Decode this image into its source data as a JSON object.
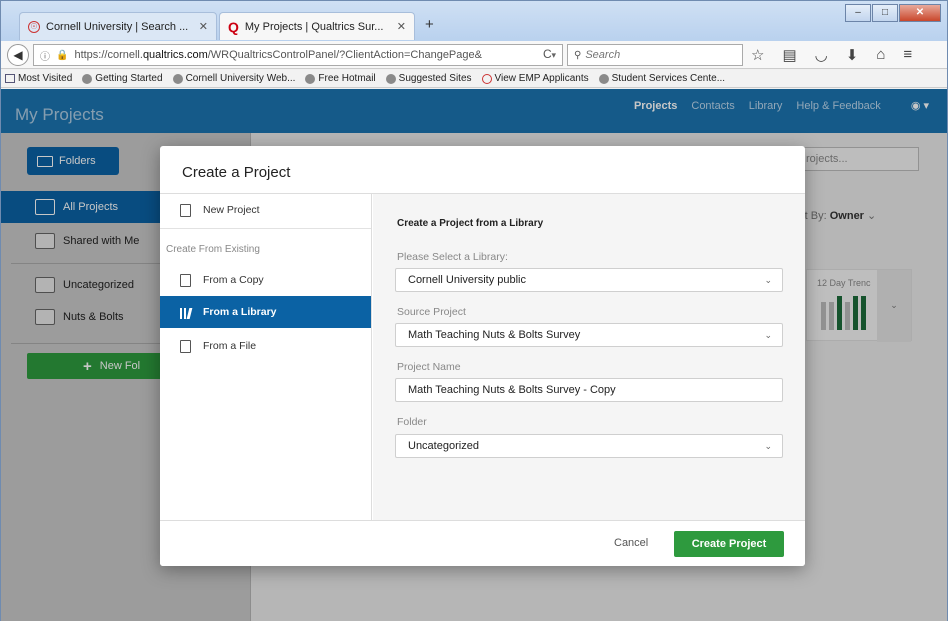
{
  "browser": {
    "tabs": [
      {
        "title": "Cornell University | Search ...",
        "active": false
      },
      {
        "title": "My Projects | Qualtrics Sur...",
        "active": true
      }
    ],
    "new_tab": "+",
    "url_prefix": "https://cornell.",
    "url_domain": "qualtrics.com",
    "url_path": "/WRQualtricsControlPanel/?ClientAction=ChangePage&",
    "search_placeholder": "Search",
    "bookmarks": [
      "Most Visited",
      "Getting Started",
      "Cornell University Web...",
      "Free Hotmail",
      "Suggested Sites",
      "View EMP Applicants",
      "Student Services Cente..."
    ]
  },
  "app": {
    "title": "My Projects",
    "nav": [
      "Projects",
      "Contacts",
      "Library",
      "Help & Feedback"
    ],
    "folders_label": "Folders",
    "sidebar": [
      "All Projects",
      "Shared with Me",
      "Uncategorized",
      "Nuts & Bolts"
    ],
    "new_folder_label": "New Fol",
    "search_placeholder": "rojects...",
    "sort_prefix": "rt By:",
    "sort_value": "Owner",
    "trend_label": "12 Day Trenc",
    "accent": "#1b74b0",
    "green": "#2e9a3e"
  },
  "modal": {
    "title": "Create a Project",
    "left": {
      "new_project": "New Project",
      "heading": "Create From Existing",
      "items": [
        "From a Copy",
        "From a Library",
        "From a File"
      ]
    },
    "right": {
      "title": "Create a Project from a Library",
      "library_label": "Please Select a Library:",
      "library_value": "Cornell University public",
      "source_label": "Source Project",
      "source_value": "Math Teaching Nuts & Bolts Survey",
      "name_label": "Project Name",
      "name_value": "Math Teaching Nuts & Bolts Survey - Copy",
      "folder_label": "Folder",
      "folder_value": "Uncategorized"
    },
    "cancel": "Cancel",
    "create": "Create Project"
  }
}
